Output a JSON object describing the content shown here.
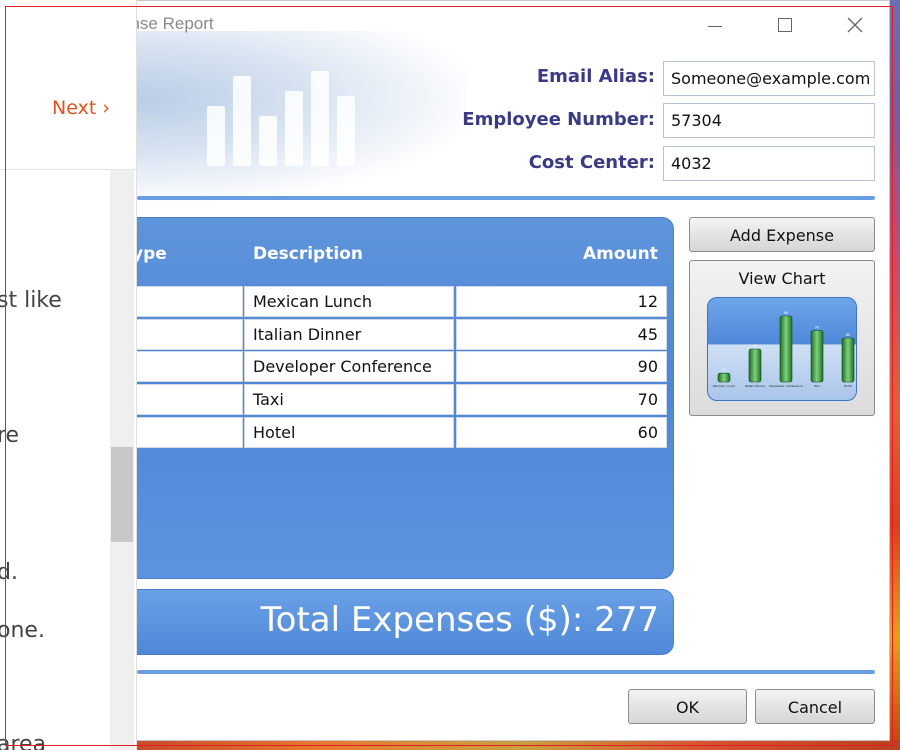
{
  "window": {
    "title": "ense Report",
    "controls": {
      "minimize": "minimize",
      "maximize": "maximize",
      "close": "×"
    }
  },
  "form": {
    "email_label": "Email Alias:",
    "email_value": "Someone@example.com",
    "employee_label": "Employee Number:",
    "employee_value": "57304",
    "cost_label": "Cost Center:",
    "cost_value": "4032"
  },
  "grid": {
    "headers": {
      "type": "ype",
      "description": "Description",
      "amount": "Amount"
    },
    "rows": [
      {
        "description": "Mexican Lunch",
        "amount": "12"
      },
      {
        "description": "Italian Dinner",
        "amount": "45"
      },
      {
        "description": "Developer Conference",
        "amount": "90"
      },
      {
        "description": "Taxi",
        "amount": "70"
      },
      {
        "description": "Hotel",
        "amount": "60"
      }
    ]
  },
  "total": {
    "label": "Total Expenses ($):  277"
  },
  "buttons": {
    "add_expense": "Add Expense",
    "view_chart": "View Chart",
    "ok": "OK",
    "cancel": "Cancel"
  },
  "left_panel": {
    "next": "Next",
    "next_chevron": "›",
    "fragments": [
      "st like",
      "re",
      "d.",
      "one.",
      "area"
    ]
  },
  "colors": {
    "accent_blue": "#4f86d6",
    "label_navy": "#3a3a86",
    "next_orange": "#e0531e"
  }
}
